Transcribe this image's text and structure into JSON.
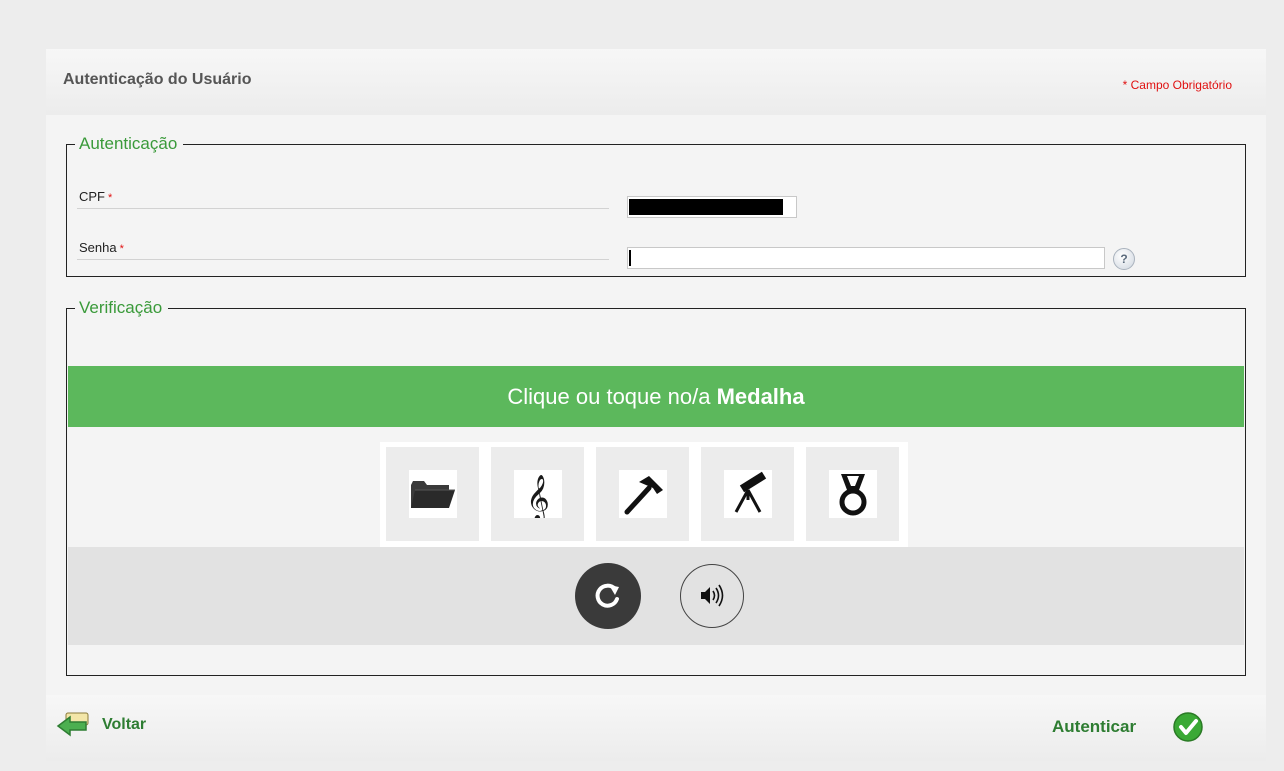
{
  "header": {
    "title": "Autenticação do Usuário",
    "required_note": "* Campo Obrigatório"
  },
  "auth": {
    "legend": "Autenticação",
    "cpf_label": "CPF",
    "senha_label": "Senha",
    "required_mark": "*",
    "help_symbol": "?"
  },
  "verification": {
    "legend": "Verificação",
    "prompt_prefix": "Clique ou toque no/a ",
    "prompt_target": "Medalha",
    "icons": [
      "folder-icon",
      "treble-clef-icon",
      "hammer-icon",
      "telescope-icon",
      "medal-icon"
    ],
    "controls": [
      "refresh-icon",
      "audio-icon"
    ]
  },
  "footer": {
    "back_label": "Voltar",
    "submit_label": "Autenticar"
  },
  "colors": {
    "accent_green": "#5cb85c",
    "required_red": "#e01010",
    "link_green": "#2e7d32"
  }
}
